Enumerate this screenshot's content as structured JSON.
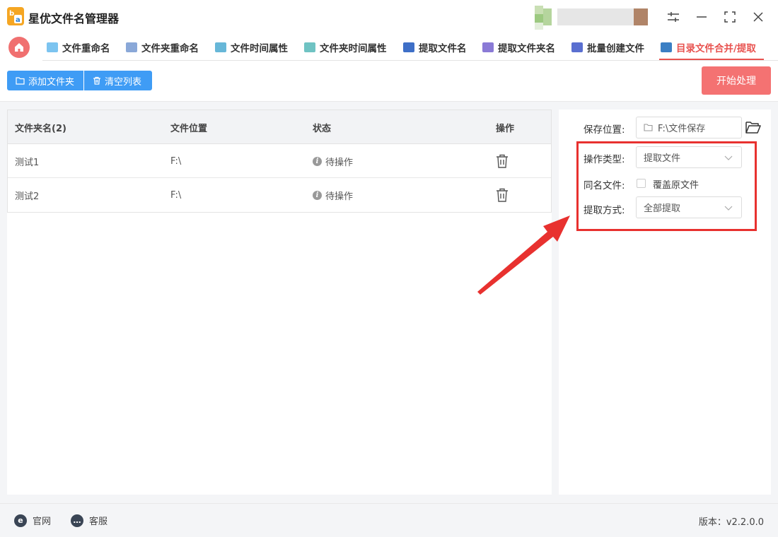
{
  "app": {
    "title": "星优文件名管理器"
  },
  "tabs": [
    {
      "label": "文件重命名",
      "color": "#7cc4f0"
    },
    {
      "label": "文件夹重命名",
      "color": "#8aa8d8"
    },
    {
      "label": "文件时间属性",
      "color": "#67b7d8"
    },
    {
      "label": "文件夹时间属性",
      "color": "#6fc3c3"
    },
    {
      "label": "提取文件名",
      "color": "#3e6fc7"
    },
    {
      "label": "提取文件夹名",
      "color": "#8a7ad6"
    },
    {
      "label": "批量创建文件",
      "color": "#5a6fd0"
    },
    {
      "label": "目录文件合并/提取",
      "color": "#3b7fc4"
    }
  ],
  "toolbar": {
    "add_folder": "添加文件夹",
    "clear_list": "清空列表",
    "start": "开始处理"
  },
  "table": {
    "headers": [
      "文件夹名(2)",
      "文件位置",
      "状态",
      "操作"
    ],
    "rows": [
      {
        "name": "测试1",
        "location": "F:\\",
        "status": "待操作"
      },
      {
        "name": "测试2",
        "location": "F:\\",
        "status": "待操作"
      }
    ]
  },
  "settings": {
    "save_label": "保存位置:",
    "save_path": "F:\\文件保存",
    "op_type_label": "操作类型:",
    "op_type_value": "提取文件",
    "same_name_label": "同名文件:",
    "overwrite_label": "覆盖原文件",
    "overwrite_checked": false,
    "extract_mode_label": "提取方式:",
    "extract_mode_value": "全部提取"
  },
  "footer": {
    "website": "官网",
    "support": "客服",
    "version": "版本：v2.2.0.0"
  },
  "colors": {
    "accent": "#e8524f",
    "primary": "#3f9cf5",
    "start_button": "#f47272",
    "highlight_box": "#e8312f"
  }
}
